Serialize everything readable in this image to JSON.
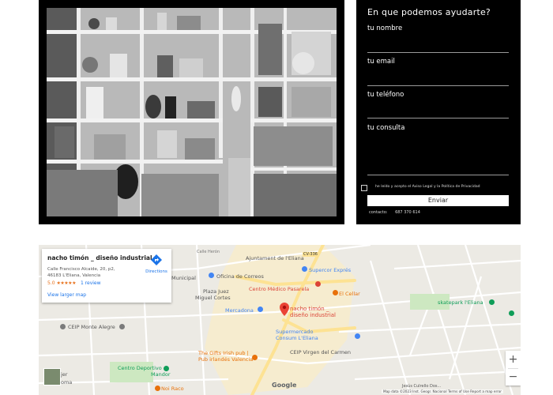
{
  "contact": {
    "title": "En que podemos ayudarte?",
    "name_label": "tu nombre",
    "email_label": "tu email",
    "phone_label": "tu teléfono",
    "message_label": "tu consulta",
    "consent_text": "he leído y acepto el Aviso Legal y la Política de Privacidad",
    "send_label": "Enviar",
    "contact_label": "contacto:",
    "phone_number": "687 370 614"
  },
  "map": {
    "place": {
      "name": "nacho timón _ diseño industrial",
      "address_line1": "Calle Francisco Alcaide, 20, p2,",
      "address_line2": "46183 L'Eliana, Valencia",
      "rating": "5.0",
      "stars": "★★★★★",
      "reviews": "1 review",
      "larger_map": "View larger map",
      "directions": "Directions"
    },
    "labels": {
      "calle_heron": "Calle Herón",
      "ajuntament": "Ajuntament de l'Eliana",
      "cv": "CV-336",
      "municipal": "Municipal",
      "oficina": "Oficina de Correos",
      "supercor": "Supercor Exprés",
      "plaza1": "Plaza Juez",
      "plaza2": "Miguel Cortes",
      "centro_medico": "Centro Médico Pasarela",
      "cellar": "El Cellar",
      "marker1": "nacho timón _",
      "marker2": "diseño industrial",
      "mercadona": "Mercadona",
      "skatepark": "skatepark l'Eliana",
      "ceip_monte": "CEIP Monte Alegre",
      "supermercado1": "Supermercado",
      "supermercado2": "Consum L'Eliana",
      "ceip_carmen": "CEIP Virgen del Carmen",
      "pub1": "The Gifts Irish pub |",
      "pub2": "Pub irlandés Valencia",
      "centro_dep1": "Centro Deportivo",
      "centro_dep2": "Mandor",
      "noi": "Noi Raco",
      "pegman1": "jer",
      "pegman2": "oma",
      "jesus": "Jesús Culrello Dos..."
    },
    "google_logo": "Google",
    "attribution": "Map data ©2023 Inst. Geogr. Nacional   Terms of Use   Report a map error",
    "zoom_in": "+",
    "zoom_out": "−",
    "colors": {
      "water": "#aadaff",
      "road_major": "#fde293",
      "poi_red": "#db4437",
      "poi_green": "#0f9d58",
      "poi_orange": "#e8710a",
      "poi_blue": "#4285f4"
    }
  }
}
